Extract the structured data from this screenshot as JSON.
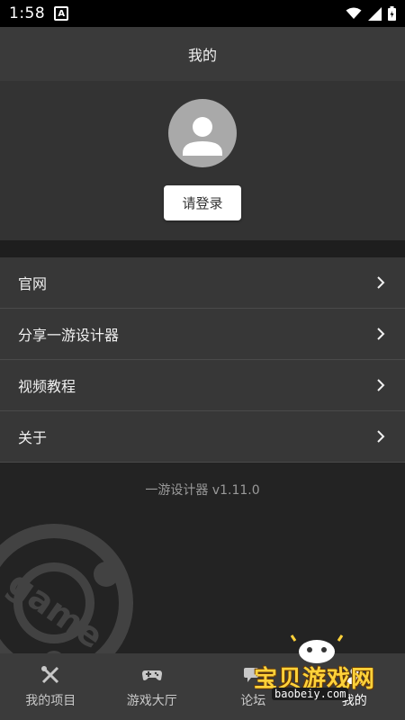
{
  "status": {
    "time": "1:58",
    "app_icon_letter": "A"
  },
  "header": {
    "title": "我的"
  },
  "profile": {
    "login_label": "请登录"
  },
  "menu": {
    "items": [
      {
        "label": "官网"
      },
      {
        "label": "分享一游设计器"
      },
      {
        "label": "视频教程"
      },
      {
        "label": "关于"
      }
    ]
  },
  "version_text": "一游设计器 v1.11.0",
  "background_decoration_text": "game",
  "bottom_nav": {
    "items": [
      {
        "label": "我的项目",
        "icon": "wrench-pencil-icon"
      },
      {
        "label": "游戏大厅",
        "icon": "gamepad-icon"
      },
      {
        "label": "论坛",
        "icon": "forum-icon"
      },
      {
        "label": "我的",
        "icon": "person-icon"
      }
    ]
  },
  "watermark": {
    "title": "宝贝游戏网",
    "url": "baobeiy.com"
  },
  "colors": {
    "app_bar": "#3a3a3a",
    "profile_bg": "#333333",
    "menu_bg": "#373737",
    "body_bg": "#232323",
    "nav_bg": "#3b3b3b"
  }
}
